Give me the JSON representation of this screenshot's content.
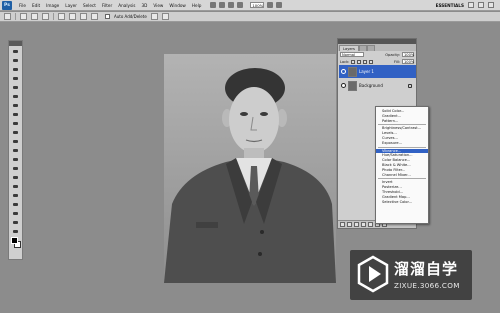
{
  "menubar": {
    "app_logo": "Ps",
    "menus": [
      "File",
      "Edit",
      "Image",
      "Layer",
      "Select",
      "Filter",
      "Analysis",
      "3D",
      "View",
      "Window",
      "Help"
    ],
    "zoom": "100%",
    "workspace": "ESSENTIALS"
  },
  "optbar": {
    "auto_add_delete": "Auto Add/Delete"
  },
  "layers_panel": {
    "tabs": [
      "Layers"
    ],
    "blend_mode": "Normal",
    "opacity_label": "Opacity:",
    "opacity_value": "100%",
    "lock_label": "Lock:",
    "fill_label": "Fill:",
    "fill_value": "100%",
    "layers": [
      {
        "name": "Layer 1",
        "selected": true
      },
      {
        "name": "Background",
        "selected": false
      }
    ]
  },
  "context_menu": {
    "groups": [
      [
        "Solid Color...",
        "Gradient...",
        "Pattern..."
      ],
      [
        "Brightness/Contrast...",
        "Levels...",
        "Curves...",
        "Exposure..."
      ],
      [
        "Vibrance...",
        "Hue/Saturation...",
        "Color Balance...",
        "Black & White...",
        "Photo Filter...",
        "Channel Mixer..."
      ],
      [
        "Invert",
        "Posterize...",
        "Threshold...",
        "Gradient Map...",
        "Selective Color..."
      ]
    ],
    "highlighted": "Vibrance..."
  },
  "watermark": {
    "brand_cn": "溜溜自学",
    "url": "ZIXUE.3066.COM"
  },
  "colors": {
    "selection_blue": "#3161c4",
    "workspace_gray": "#8c8c8c"
  }
}
